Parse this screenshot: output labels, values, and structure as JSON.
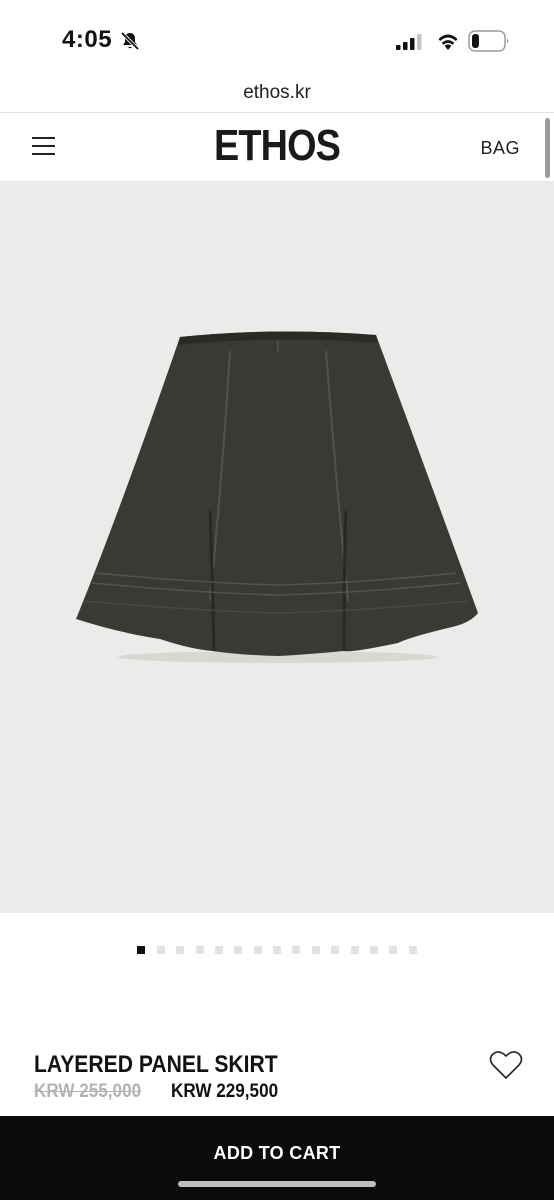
{
  "status_bar": {
    "time": "4:05"
  },
  "browser": {
    "url": "ethos.kr"
  },
  "header": {
    "brand": "ETHOS",
    "bag_label": "BAG"
  },
  "gallery": {
    "total_images": 15,
    "active_index": 0
  },
  "product": {
    "name": "LAYERED PANEL SKIRT",
    "original_price": "KRW 255,000",
    "sale_price": "KRW 229,500"
  },
  "cta": {
    "add_to_cart_label": "ADD TO CART"
  },
  "colors": {
    "accent": "#0b0b0b",
    "image_background": "#ecebe9",
    "skirt": "#3a3834",
    "muted_price": "#b3b3b3"
  }
}
